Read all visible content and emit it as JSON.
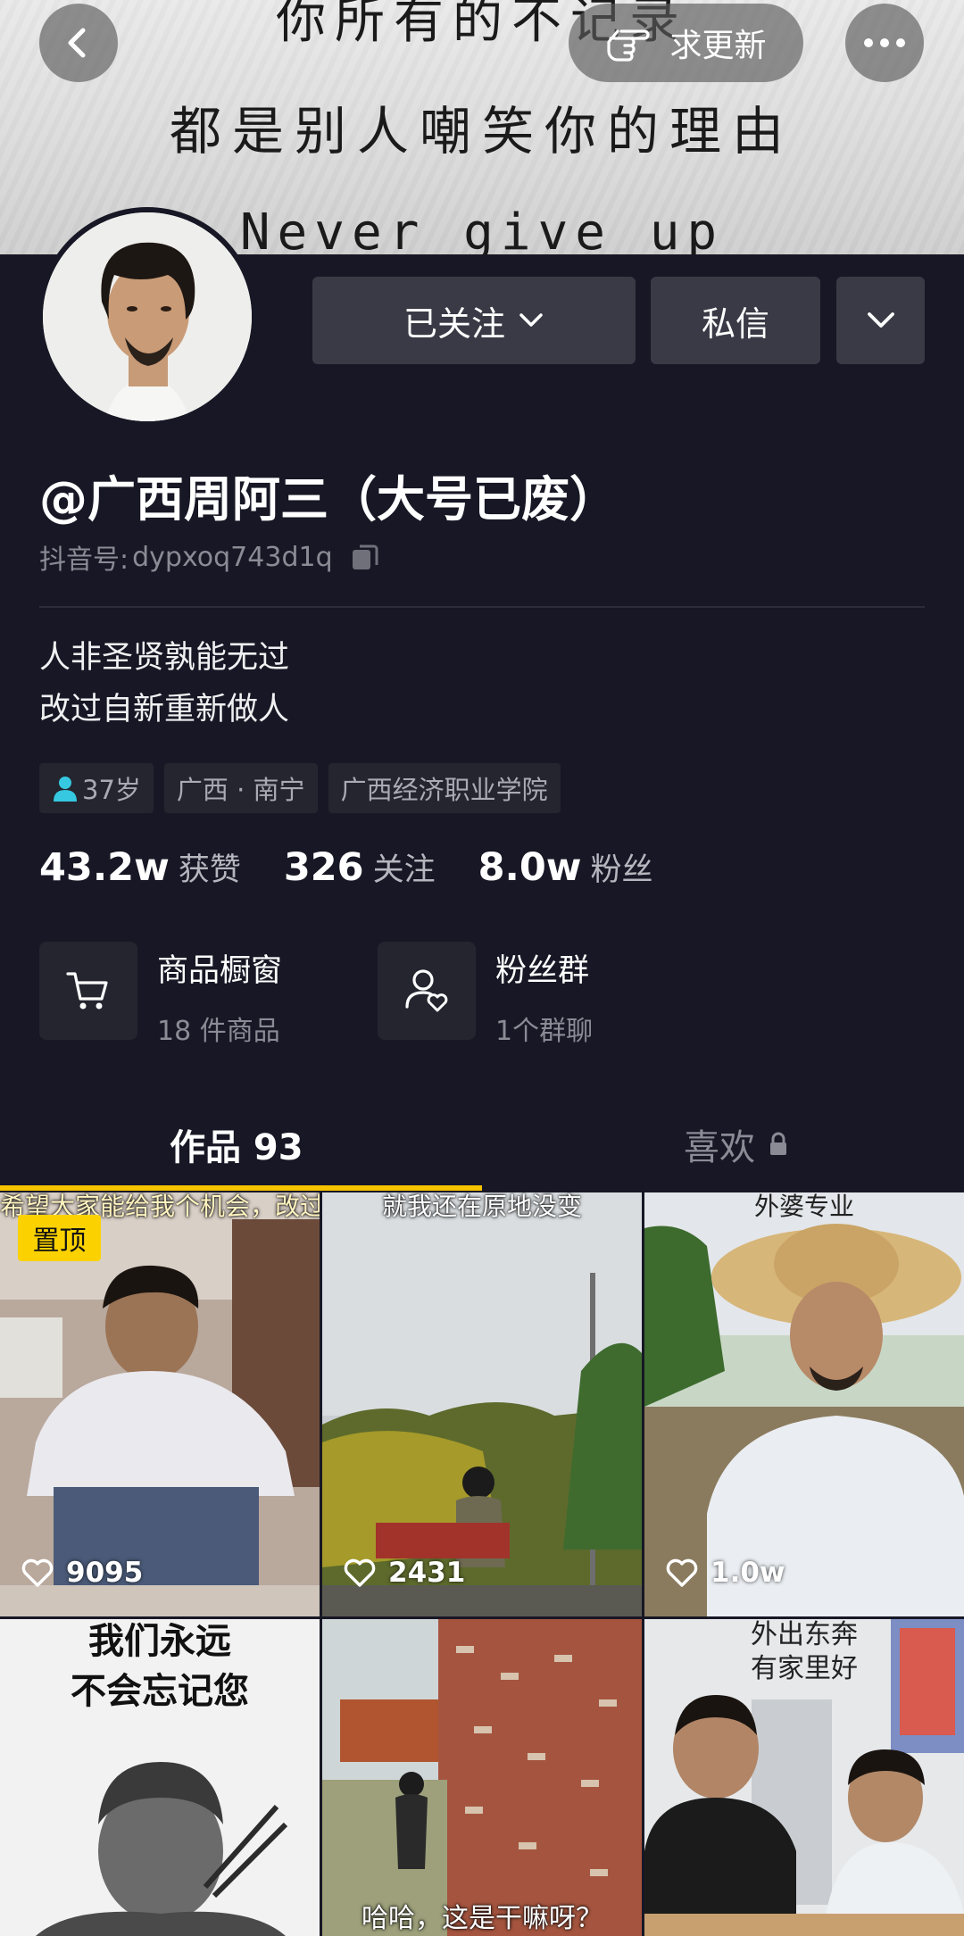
{
  "banner": {
    "line1": "你所有的不记录",
    "line2": "都是别人嘲笑你的理由",
    "line3": "Never give up"
  },
  "topbar": {
    "update_label": "求更新"
  },
  "profile": {
    "follow_label": "已关注",
    "message_label": "私信",
    "name": "@广西周阿三（大号已废）",
    "douyin_id_label": "抖音号: ",
    "douyin_id": "dypxoq743d1q",
    "bio_line1": "人非圣贤孰能无过",
    "bio_line2": "改过自新重新做人",
    "tags": [
      "37岁",
      "广西 · 南宁",
      "广西经济职业学院"
    ],
    "stats": [
      {
        "num": "43.2w",
        "label": "获赞"
      },
      {
        "num": "326",
        "label": "关注"
      },
      {
        "num": "8.0w",
        "label": "粉丝"
      }
    ]
  },
  "features": {
    "shop_title": "商品橱窗",
    "shop_sub": "18 件商品",
    "fans_title": "粉丝群",
    "fans_sub": "1个群聊"
  },
  "tabs": {
    "works": "作品 93",
    "likes": "喜欢"
  },
  "videos": [
    {
      "caption": "希望大家能给我个机会，改过自新、重新做人！",
      "pinned_label": "置顶",
      "likes": "9095"
    },
    {
      "caption": "就我还在原地没变",
      "likes": "2431"
    },
    {
      "caption": "外婆专业",
      "likes": "1.0w"
    },
    {
      "caption_line1": "我们永远",
      "caption_line2": "不会忘记您"
    },
    {
      "caption": "哈哈，这是干嘛呀？"
    },
    {
      "caption_line1": "外出东奔",
      "caption_line2": "有家里好"
    }
  ],
  "colors": {
    "background": "#171725",
    "button": "#393a45",
    "accent_yellow": "#f5c300",
    "pin_yellow": "#fbd200",
    "muted_text": "#8a8b95",
    "tag_icon": "#35c8e0"
  }
}
